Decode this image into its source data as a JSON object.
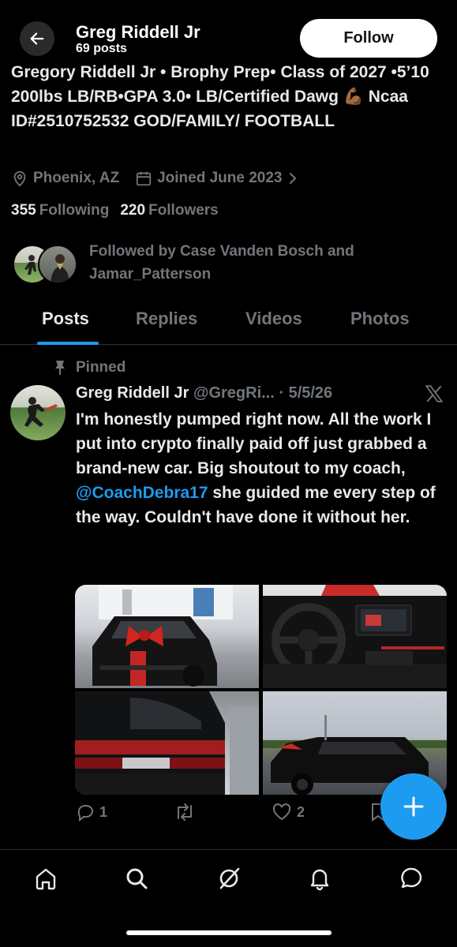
{
  "header": {
    "name": "Greg Riddell Jr",
    "posts_count": "69 posts",
    "follow_label": "Follow"
  },
  "profile": {
    "bio": "Gregory Riddell Jr • Brophy Prep• Class of 2027 •5’10 200lbs LB/RB•GPA 3.0• LB/Certified Dawg 💪🏾 Ncaa ID#2510752532 GOD/FAMILY/ FOOTBALL",
    "location": "Phoenix, AZ",
    "joined": "Joined June 2023",
    "following_count": "355",
    "following_label": "Following",
    "followers_count": "220",
    "followers_label": "Followers",
    "followed_by": "Followed by Case Vanden Bosch and Jamar_Patterson"
  },
  "tabs": [
    {
      "label": "Posts",
      "active": true
    },
    {
      "label": "Replies",
      "active": false
    },
    {
      "label": "Videos",
      "active": false
    },
    {
      "label": "Photos",
      "active": false
    }
  ],
  "post": {
    "pinned_label": "Pinned",
    "author_name": "Greg Riddell Jr",
    "handle": "@GregRi...",
    "date": "· 5/5/26",
    "text_before": "I'm honestly pumped right now. All the work I put into crypto finally paid off just grabbed a brand-new car. Big shoutout to my coach, ",
    "mention": "@CoachDebra17",
    "text_after": " she guided me every step of the way. Couldn't have done it without her.",
    "replies": "1",
    "reposts": "",
    "likes": "2"
  },
  "icons": {
    "back": "arrow-left-icon",
    "location": "map-pin-icon",
    "calendar": "calendar-icon",
    "chevron": "chevron-right-icon",
    "pin": "pin-icon",
    "x_logo": "x-logo-icon",
    "reply": "reply-icon",
    "repost": "repost-icon",
    "like": "heart-icon",
    "bookmark": "bookmark-icon",
    "compose": "plus-icon",
    "nav": [
      "home-icon",
      "search-icon",
      "grok-icon",
      "bell-icon",
      "chat-icon"
    ]
  },
  "colors": {
    "background": "#000000",
    "accent": "#1d9bf0",
    "text_primary": "#e7e9ea",
    "text_secondary": "#71767b"
  }
}
